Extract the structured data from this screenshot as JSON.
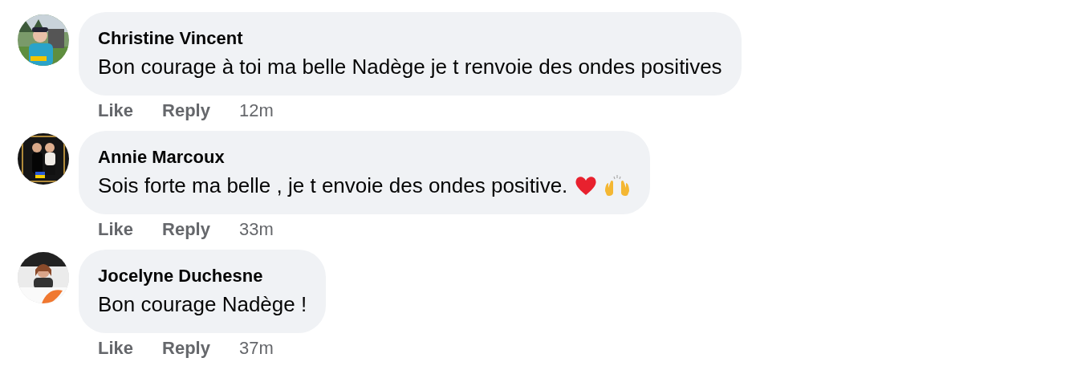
{
  "comments": [
    {
      "author": "Christine Vincent",
      "avatar": {
        "kind": "picture"
      },
      "message": "Bon courage à toi ma belle Nadège je t renvoie des ondes positives",
      "actions": [
        "Like",
        "Reply"
      ],
      "time": "12m"
    },
    {
      "author": "Annie Marcoux",
      "avatar": {
        "kind": "picture"
      },
      "message": "Sois forte ma belle , je t envoie des ondes positive.",
      "emojis": [
        {
          "kind": "heart"
        },
        {
          "kind": "raised-hands"
        }
      ],
      "actions": [
        "Like",
        "Reply"
      ],
      "time": "33m"
    },
    {
      "author": "Jocelyne Duchesne",
      "avatar": {
        "kind": "picture"
      },
      "message": "Bon courage Nadège !",
      "actions": [
        "Like",
        "Reply"
      ],
      "time": "37m"
    }
  ]
}
